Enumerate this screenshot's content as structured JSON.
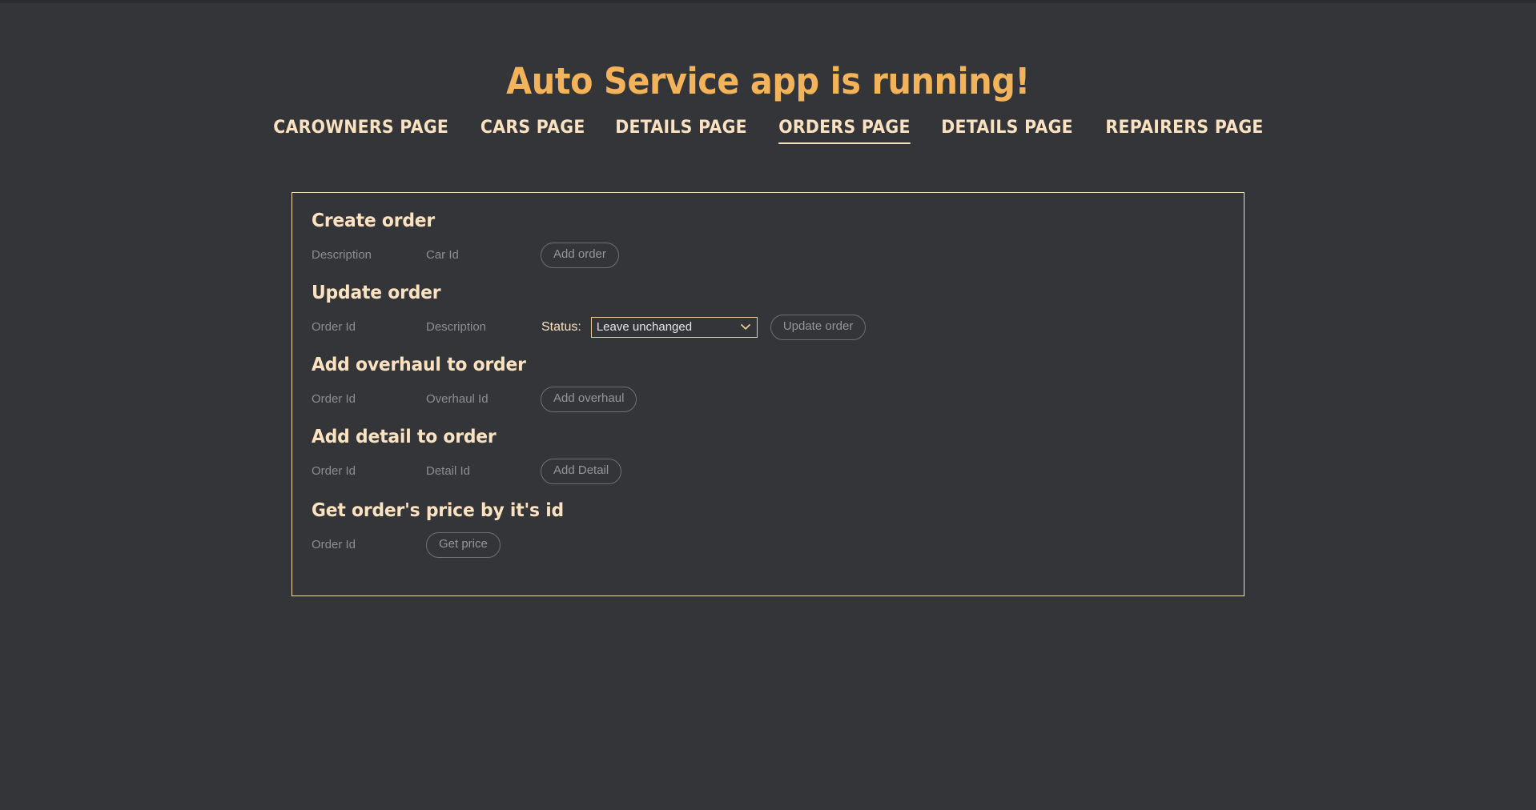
{
  "app": {
    "title": "Auto Service app is running!",
    "title_color": "#f3b35a",
    "background_color": "#343539",
    "accent_border_color": "#f4dcb3",
    "heading_color": "#fbe3c1"
  },
  "nav": {
    "items": [
      {
        "label": "CAROWNERS PAGE",
        "active": false
      },
      {
        "label": "CARS PAGE",
        "active": false
      },
      {
        "label": "DETAILS PAGE",
        "active": false
      },
      {
        "label": "ORDERS PAGE",
        "active": true
      },
      {
        "label": "DETAILS PAGE",
        "active": false
      },
      {
        "label": "REPAIRERS PAGE",
        "active": false
      }
    ]
  },
  "sections": {
    "create_order": {
      "heading": "Create order",
      "description_placeholder": "Description",
      "description_value": "",
      "car_id_placeholder": "Car Id",
      "car_id_value": "",
      "button_label": "Add order"
    },
    "update_order": {
      "heading": "Update order",
      "order_id_placeholder": "Order Id",
      "order_id_value": "",
      "description_placeholder": "Description",
      "description_value": "",
      "status_label": "Status:",
      "status_selected": "Leave unchanged",
      "status_options": [
        "Leave unchanged"
      ],
      "chevron": "⌄",
      "button_label": "Update order"
    },
    "add_overhaul": {
      "heading": "Add overhaul to order",
      "order_id_placeholder": "Order Id",
      "order_id_value": "",
      "overhaul_id_placeholder": "Overhaul Id",
      "overhaul_id_value": "",
      "button_label": "Add overhaul"
    },
    "add_detail": {
      "heading": "Add detail to order",
      "order_id_placeholder": "Order Id",
      "order_id_value": "",
      "detail_id_placeholder": "Detail Id",
      "detail_id_value": "",
      "button_label": "Add Detail"
    },
    "get_price": {
      "heading": "Get order's price by it's id",
      "order_id_placeholder": "Order Id",
      "order_id_value": "",
      "button_label": "Get price"
    }
  }
}
